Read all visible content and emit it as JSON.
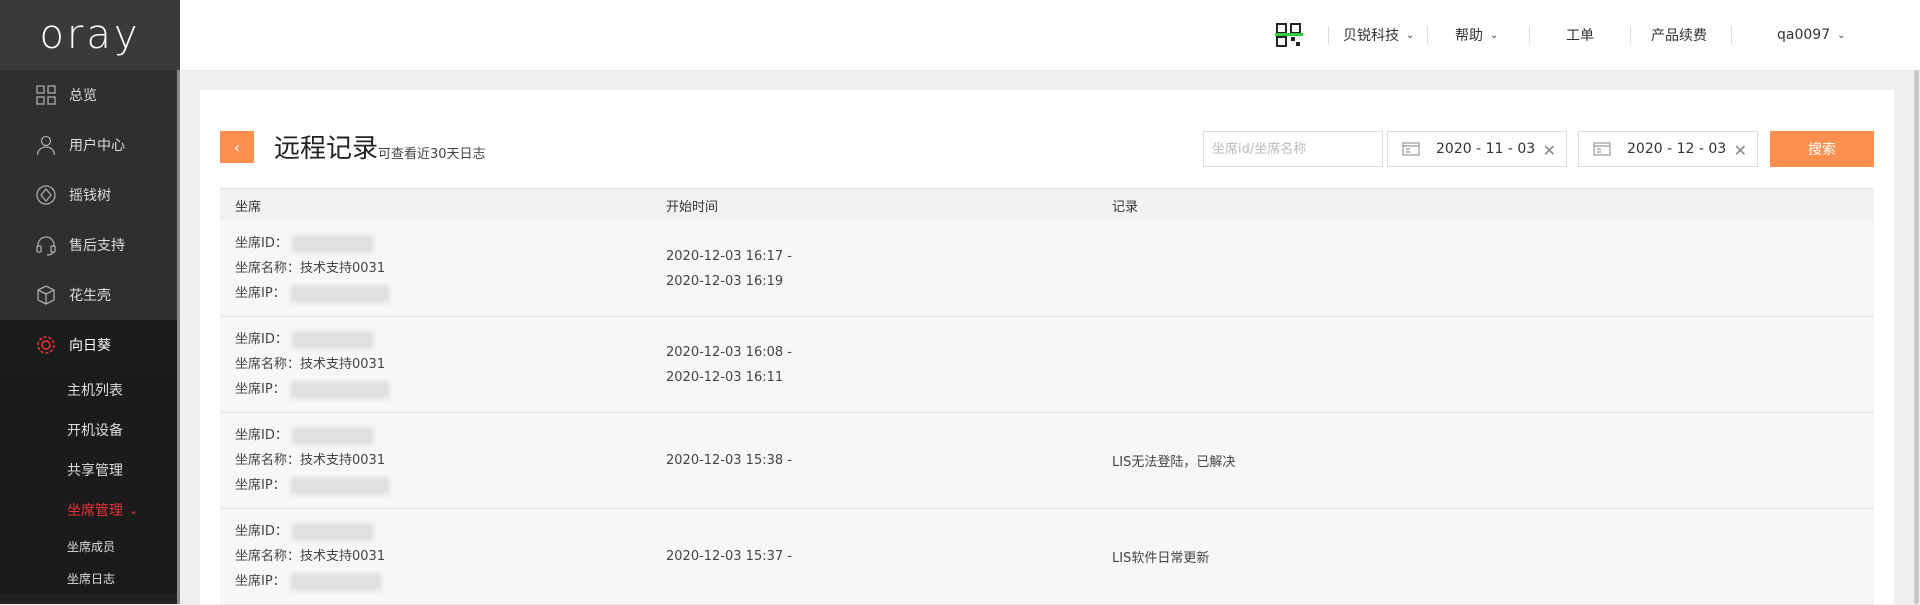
{
  "brand": {
    "logo": "oray"
  },
  "sidebar": {
    "items": [
      {
        "label": "总览",
        "icon": "grid-icon"
      },
      {
        "label": "用户中心",
        "icon": "user-icon"
      },
      {
        "label": "摇钱树",
        "icon": "diamond-icon"
      },
      {
        "label": "售后支持",
        "icon": "headset-icon"
      },
      {
        "label": "花生壳",
        "icon": "cube-icon"
      },
      {
        "label": "向日葵",
        "icon": "sunflower-icon"
      }
    ],
    "sub_items": [
      "主机列表",
      "开机设备",
      "共享管理",
      "坐席管理"
    ],
    "sub_sub_items": [
      "坐席成员",
      "坐席日志"
    ]
  },
  "header": {
    "company": "贝锐科技",
    "help": "帮助",
    "ticket": "工单",
    "renew": "产品续费",
    "user": "qa0097"
  },
  "page": {
    "title": "远程记录",
    "subtitle": "可查看近30天日志",
    "search_placeholder": "坐席id/坐席名称",
    "date_start": "2020 - 11 - 03",
    "date_end": "2020 - 12 - 03",
    "search_button": "搜索"
  },
  "table": {
    "headers": [
      "坐席",
      "开始时间",
      "记录"
    ],
    "labels": {
      "id": "坐席ID：",
      "name": "坐席名称：",
      "ip": "坐席IP："
    },
    "rows": [
      {
        "name": "技术支持0031",
        "time1": "2020-12-03 16:17 -",
        "time2": "2020-12-03 16:19",
        "record": ""
      },
      {
        "name": "技术支持0031",
        "time1": "2020-12-03 16:08 -",
        "time2": "2020-12-03 16:11",
        "record": ""
      },
      {
        "name": "技术支持0031",
        "time1": "2020-12-03 15:38 -",
        "time2": "",
        "record": "LIS无法登陆，已解决"
      },
      {
        "name": "技术支持0031",
        "time1": "2020-12-03 15:37 -",
        "time2": "",
        "record": "LIS软件日常更新"
      }
    ]
  },
  "colors": {
    "accent": "#ff8f4f",
    "active": "#e8323a",
    "sidebar": "#222222"
  }
}
